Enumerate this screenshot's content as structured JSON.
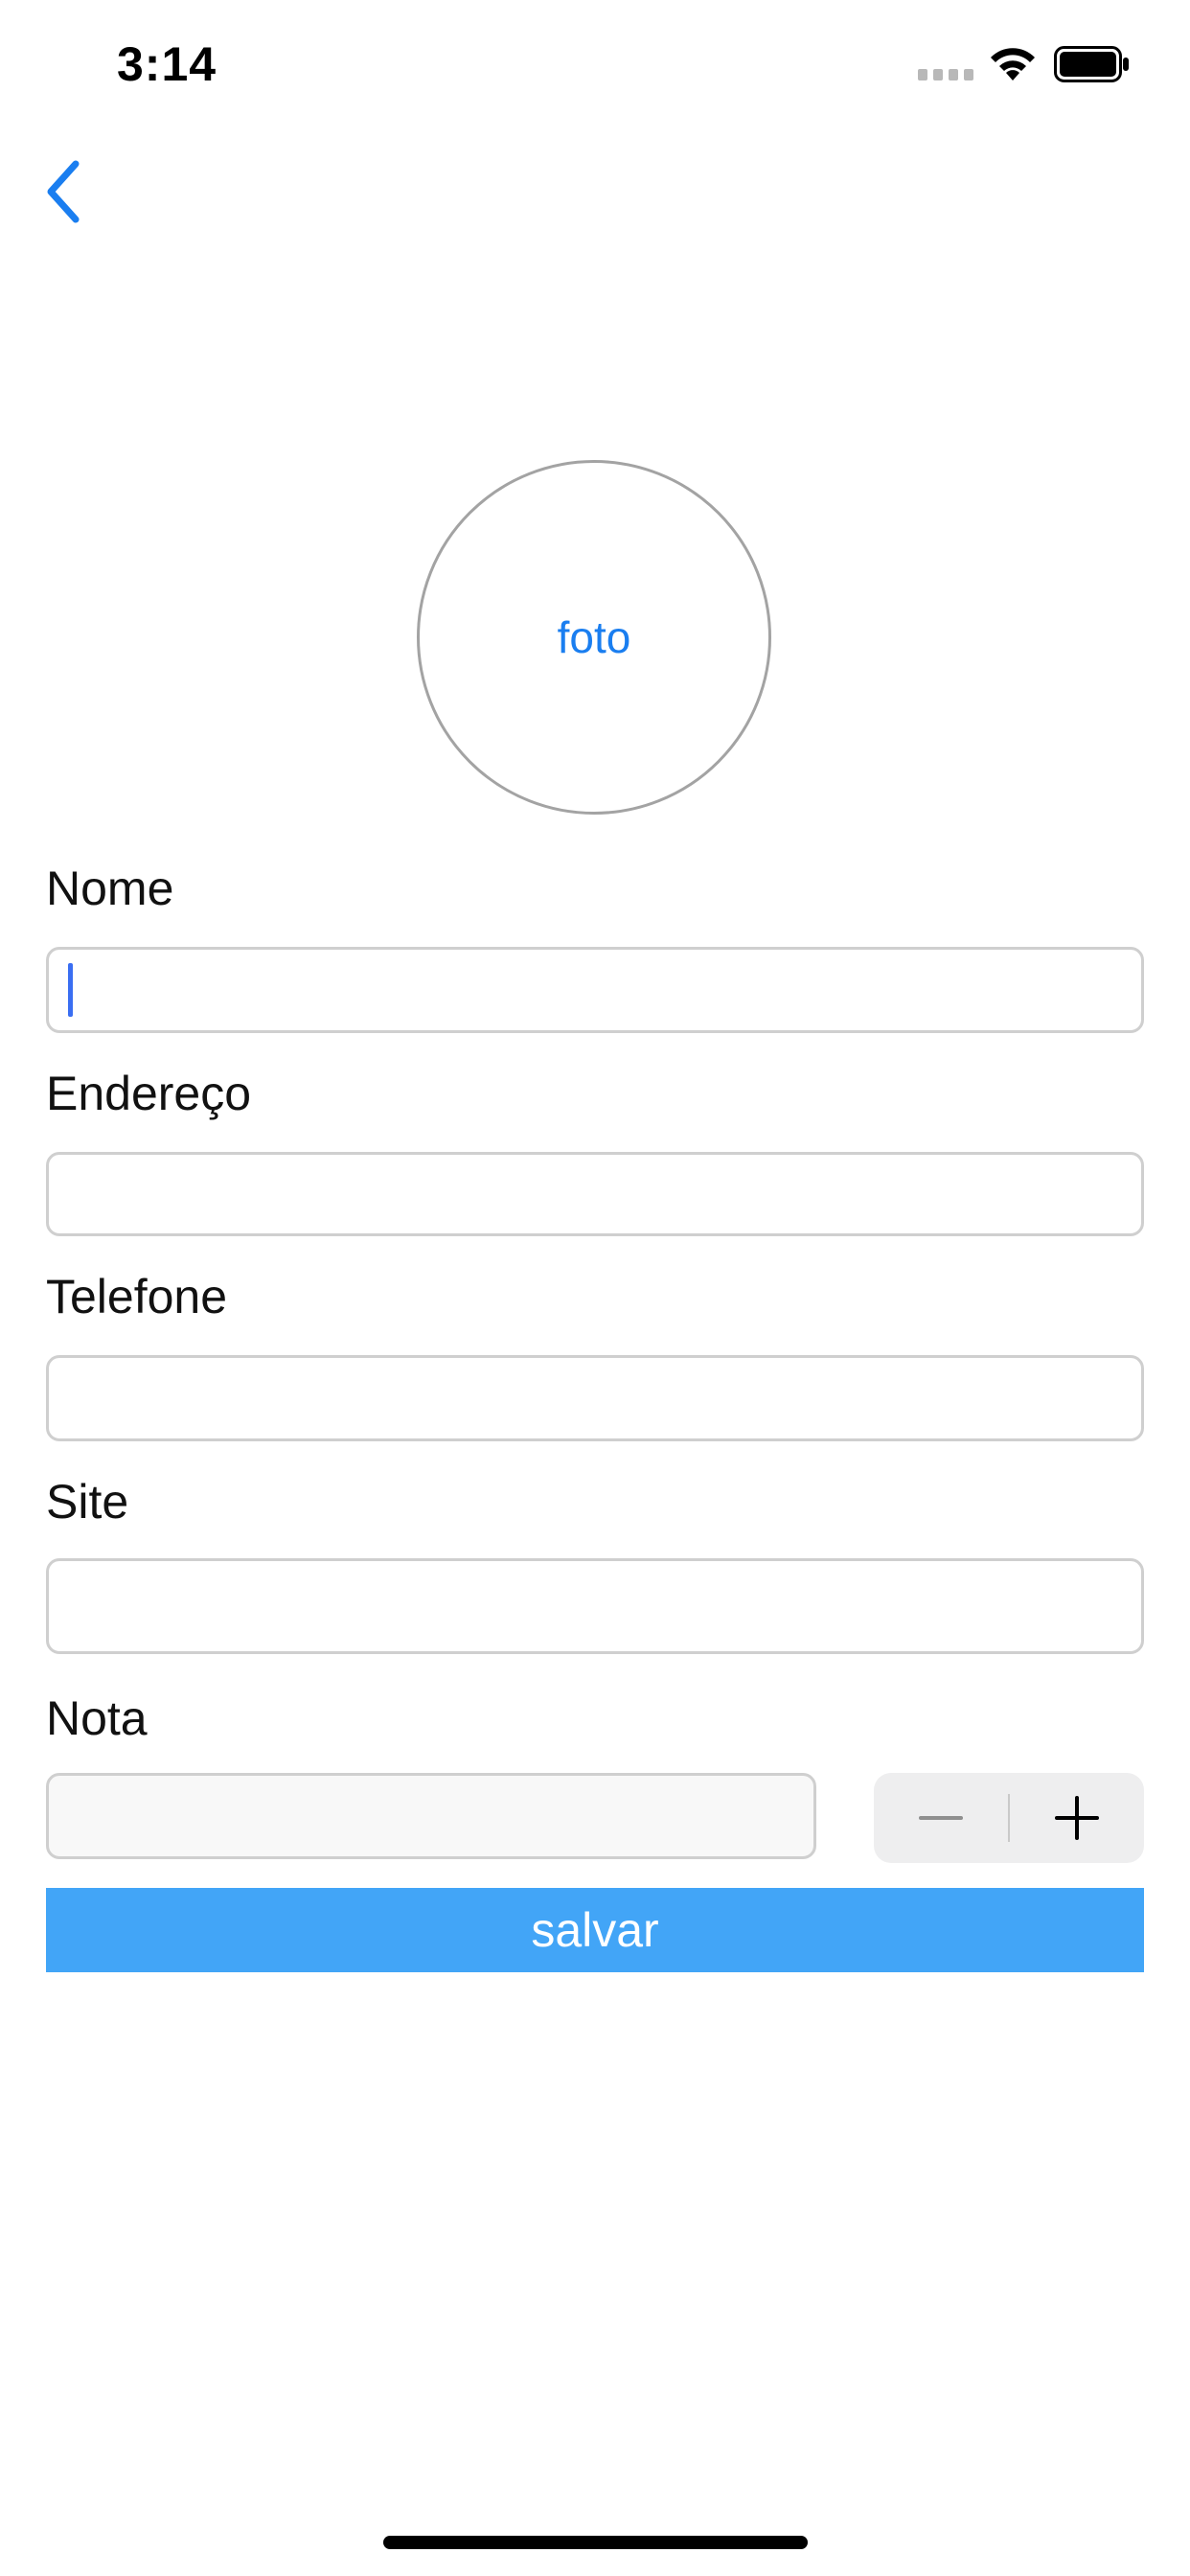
{
  "status_bar": {
    "time": "3:14"
  },
  "nav": {
    "back_icon": "chevron-left-icon",
    "accent_color": "#1a7ef0"
  },
  "photo": {
    "label": "foto"
  },
  "form": {
    "fields": [
      {
        "label": "Nome",
        "value": ""
      },
      {
        "label": "Endereço",
        "value": ""
      },
      {
        "label": "Telefone",
        "value": ""
      },
      {
        "label": "Site",
        "value": ""
      }
    ],
    "nota": {
      "label": "Nota",
      "value": ""
    },
    "stepper": {
      "minus_icon": "minus-icon",
      "plus_icon": "plus-icon"
    },
    "save_label": "salvar",
    "save_color": "#42a5f7"
  }
}
